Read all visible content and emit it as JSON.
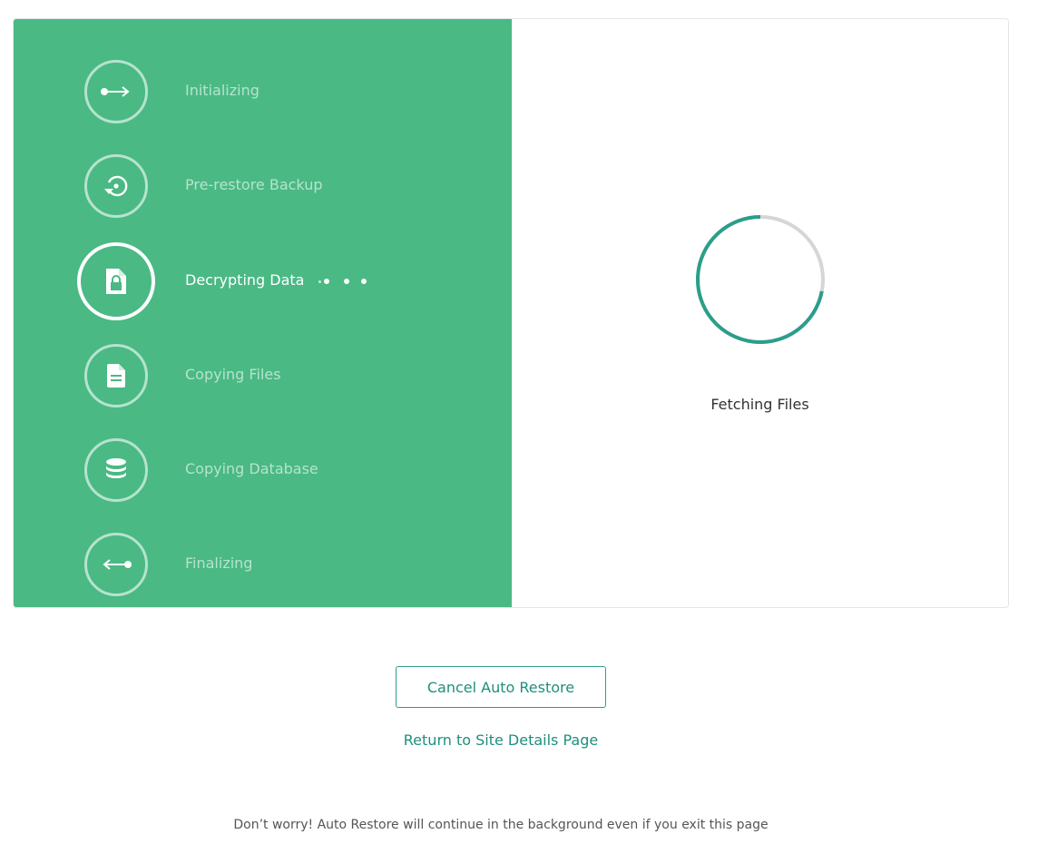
{
  "steps": [
    {
      "label": "Initializing",
      "icon": "arrow-right-icon",
      "state": "done"
    },
    {
      "label": "Pre-restore Backup",
      "icon": "history-icon",
      "state": "done"
    },
    {
      "label": "Decrypting Data",
      "icon": "file-lock-icon",
      "state": "active"
    },
    {
      "label": "Copying Files",
      "icon": "file-text-icon",
      "state": "pending"
    },
    {
      "label": "Copying Database",
      "icon": "database-icon",
      "state": "pending"
    },
    {
      "label": "Finalizing",
      "icon": "arrow-left-icon",
      "state": "pending"
    }
  ],
  "progress": {
    "status_text": "Fetching Files",
    "spinner_fraction": 0.72
  },
  "actions": {
    "cancel_label": "Cancel Auto Restore",
    "return_label": "Return to Site Details Page"
  },
  "footer": {
    "note": "Don’t worry! Auto Restore will continue in the background even if you exit this page"
  },
  "colors": {
    "panel_green": "#4ab984",
    "accent_teal": "#1f8f7c",
    "spinner_track": "#d6d6d6",
    "spinner_arc": "#2b9e8a"
  }
}
